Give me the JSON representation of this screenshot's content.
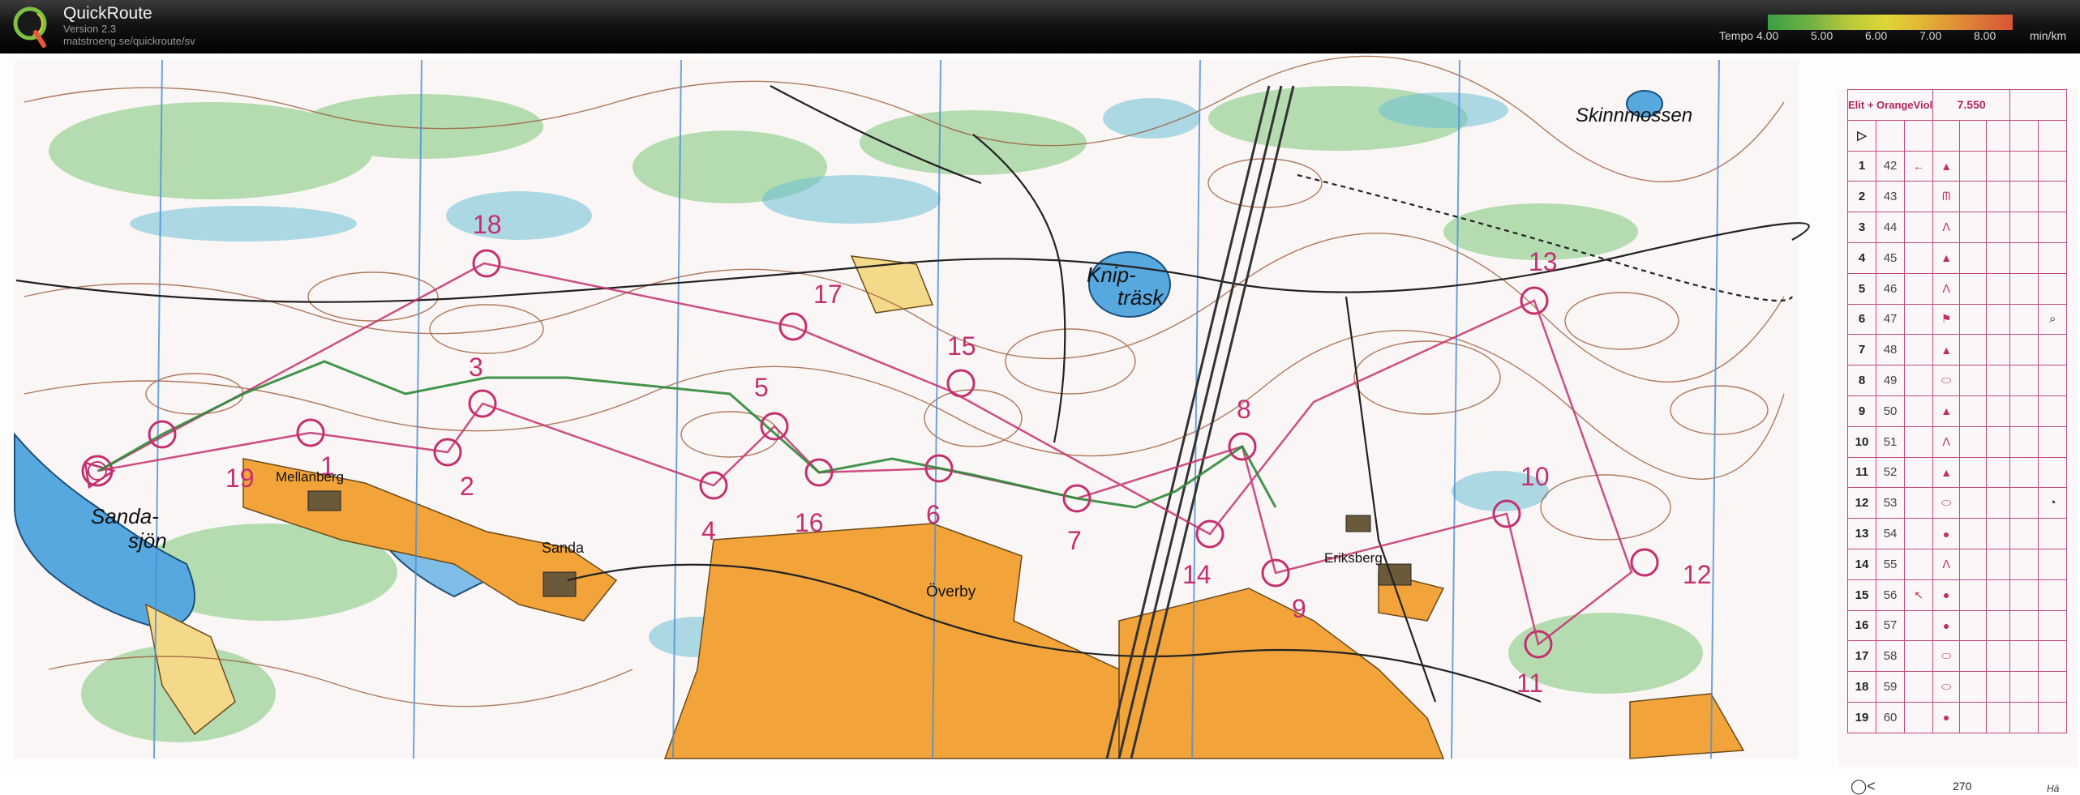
{
  "app": {
    "title": "QuickRoute",
    "version": "Version 2.3",
    "url": "matstroeng.se/quickroute/sv"
  },
  "legend": {
    "label": "Tempo",
    "ticks": [
      "4.00",
      "5.00",
      "6.00",
      "7.00",
      "8.00"
    ],
    "unit": "min/km",
    "gradient_colors": [
      "#3fae49",
      "#c9dc3e",
      "#f5ea3a",
      "#f59a3a",
      "#ee5a3a"
    ]
  },
  "map": {
    "place_names": {
      "sandasjon_1": "Sanda-",
      "sandasjon_2": "sjön",
      "mellanberg": "Mellanberg",
      "sanda": "Sanda",
      "overby": "Överby",
      "knipp_1": "Knip-",
      "knipp_2": "träsk",
      "eriksberg": "Eriksberg",
      "skinnmossen": "Skinnmossen"
    },
    "control_numbers": [
      "1",
      "2",
      "3",
      "4",
      "5",
      "6",
      "7",
      "8",
      "9",
      "10",
      "11",
      "12",
      "13",
      "14",
      "15",
      "16",
      "17",
      "18",
      "19"
    ],
    "colors": {
      "course": "#c4306e",
      "route": "#2f8a3a",
      "open_land": "#f2a43a",
      "water": "#5aa9e0",
      "marsh": "#48b0c8",
      "forest_green": "#8fcf8a",
      "power_line": "#3a3a3a"
    }
  },
  "description_sheet": {
    "course_name": "Elit + OrangeViol",
    "length": "7.550",
    "start_symbol": "▷",
    "rows": [
      {
        "order": "1",
        "code": "42",
        "which": "←",
        "feature": "▲"
      },
      {
        "order": "2",
        "code": "43",
        "which": "",
        "feature": "ᗰ"
      },
      {
        "order": "3",
        "code": "44",
        "which": "",
        "feature": "ᐱ"
      },
      {
        "order": "4",
        "code": "45",
        "which": "",
        "feature": "▲"
      },
      {
        "order": "5",
        "code": "46",
        "which": "",
        "feature": "ᐱ"
      },
      {
        "order": "6",
        "code": "47",
        "which": "",
        "feature": "⚑"
      },
      {
        "order": "7",
        "code": "48",
        "which": "",
        "feature": "▲"
      },
      {
        "order": "8",
        "code": "49",
        "which": "",
        "feature": "⬭"
      },
      {
        "order": "9",
        "code": "50",
        "which": "",
        "feature": "▲"
      },
      {
        "order": "10",
        "code": "51",
        "which": "",
        "feature": "ᐱ"
      },
      {
        "order": "11",
        "code": "52",
        "which": "",
        "feature": "▲"
      },
      {
        "order": "12",
        "code": "53",
        "which": "",
        "feature": "⬭"
      },
      {
        "order": "13",
        "code": "54",
        "which": "",
        "feature": "●"
      },
      {
        "order": "14",
        "code": "55",
        "which": "",
        "feature": "ᐱ"
      },
      {
        "order": "15",
        "code": "56",
        "which": "↖",
        "feature": "●"
      },
      {
        "order": "16",
        "code": "57",
        "which": "",
        "feature": "●"
      },
      {
        "order": "17",
        "code": "58",
        "which": "",
        "feature": "⬭"
      },
      {
        "order": "18",
        "code": "59",
        "which": "",
        "feature": "⬭"
      },
      {
        "order": "19",
        "code": "60",
        "which": "",
        "feature": "●"
      }
    ],
    "extra_row6": "⌕",
    "extra_row12": "◔",
    "footer_left": "◯<",
    "total_climb": "270",
    "footer_right": "Hä"
  }
}
